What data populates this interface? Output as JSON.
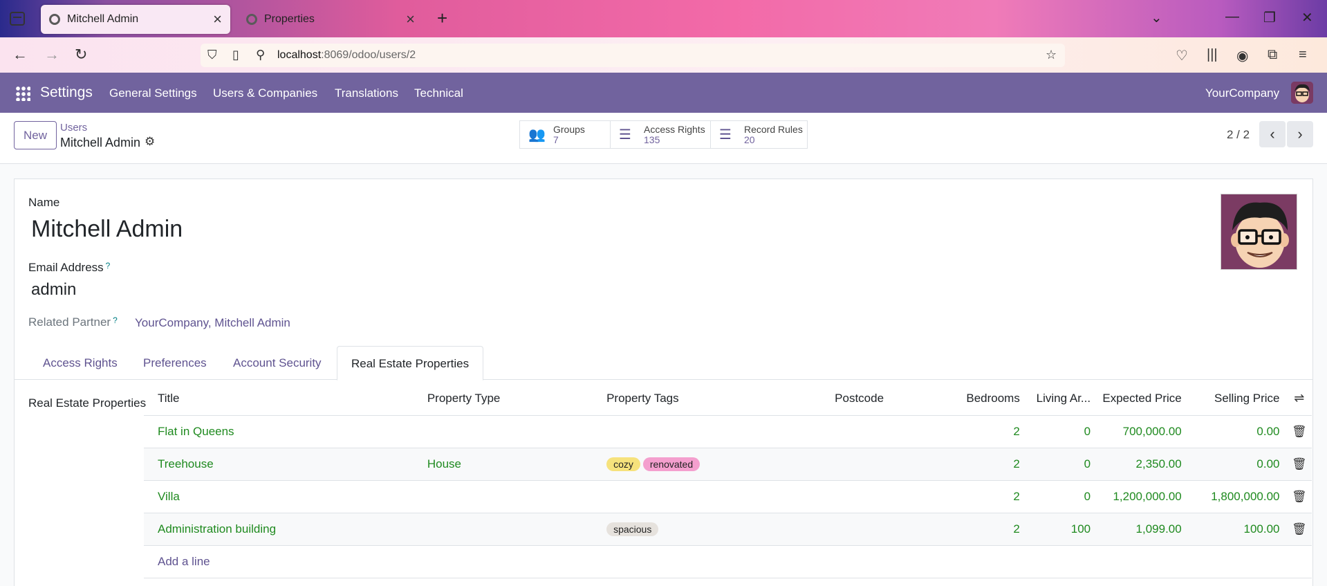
{
  "browser": {
    "tabs": [
      {
        "title": "Mitchell Admin",
        "active": true
      },
      {
        "title": "Properties",
        "active": false
      }
    ],
    "url_host": "localhost",
    "url_path": ":8069/odoo/users/2",
    "gradient_colors": [
      "#2a2a8c",
      "#e05c9c",
      "#f36aa8",
      "#6c3ca5"
    ]
  },
  "odoo_nav": {
    "app": "Settings",
    "menu": [
      "General Settings",
      "Users & Companies",
      "Translations",
      "Technical"
    ],
    "company": "YourCompany",
    "accent": "#71639e"
  },
  "control": {
    "new_label": "New",
    "breadcrumb_parent": "Users",
    "breadcrumb_current": "Mitchell Admin",
    "smart_buttons": [
      {
        "label": "Groups",
        "value": "7",
        "icon": "users-icon"
      },
      {
        "label": "Access Rights",
        "value": "135",
        "icon": "list-icon"
      },
      {
        "label": "Record Rules",
        "value": "20",
        "icon": "list-icon"
      }
    ],
    "pager": "2 / 2"
  },
  "form": {
    "name_label": "Name",
    "name_value": "Mitchell Admin",
    "email_label": "Email Address",
    "email_value": "admin",
    "partner_label": "Related Partner",
    "partner_value": "YourCompany, Mitchell Admin",
    "help_mark": "?",
    "tabs": [
      "Access Rights",
      "Preferences",
      "Account Security",
      "Real Estate Properties"
    ],
    "active_tab": "Real Estate Properties",
    "section_label": "Real Estate Properties",
    "columns": [
      "Title",
      "Property Type",
      "Property Tags",
      "Postcode",
      "Bedrooms",
      "Living Ar...",
      "Expected Price",
      "Selling Price"
    ],
    "rows": [
      {
        "title": "Flat in Queens",
        "type": "",
        "tags": [],
        "postcode": "",
        "bedrooms": "2",
        "living": "0",
        "expected": "700,000.00",
        "selling": "0.00"
      },
      {
        "title": "Treehouse",
        "type": "House",
        "tags": [
          "cozy",
          "renovated"
        ],
        "postcode": "",
        "bedrooms": "2",
        "living": "0",
        "expected": "2,350.00",
        "selling": "0.00"
      },
      {
        "title": "Villa",
        "type": "",
        "tags": [],
        "postcode": "",
        "bedrooms": "2",
        "living": "0",
        "expected": "1,200,000.00",
        "selling": "1,800,000.00"
      },
      {
        "title": "Administration building",
        "type": "",
        "tags": [
          "spacious"
        ],
        "postcode": "",
        "bedrooms": "2",
        "living": "100",
        "expected": "1,099.00",
        "selling": "100.00"
      }
    ],
    "add_line": "Add a line",
    "tag_colors": {
      "cozy": "#f6e27c",
      "renovated": "#f49fce",
      "spacious": "#e6e2dd"
    },
    "link_color": "#1f8a1f"
  }
}
